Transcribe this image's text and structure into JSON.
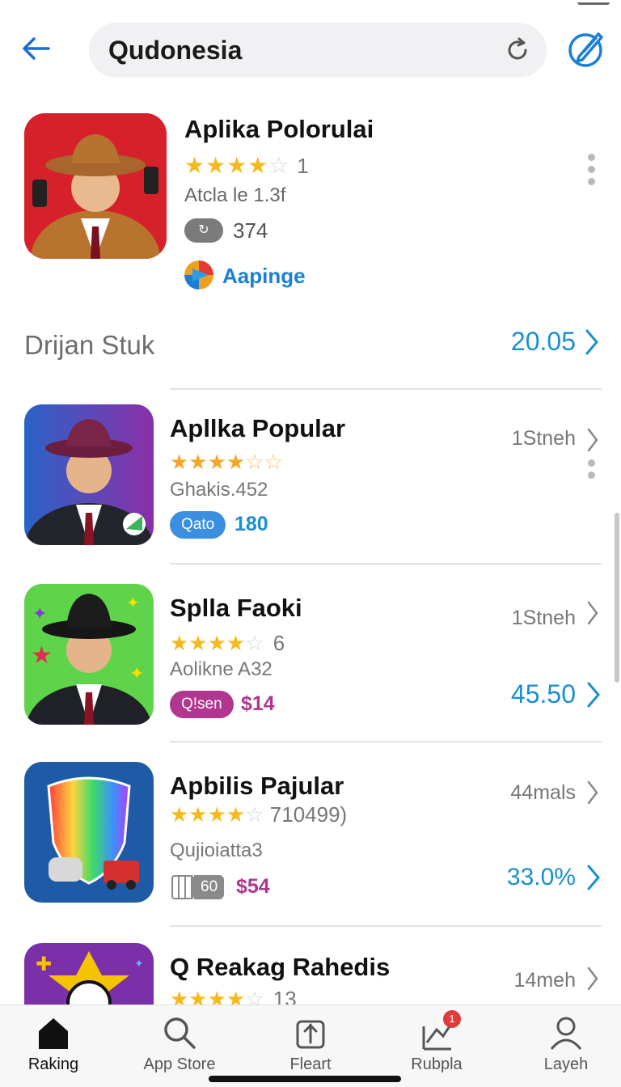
{
  "header": {
    "search_value": "Qudonesia",
    "back_icon": "back-arrow-icon",
    "refresh_icon": "refresh-icon",
    "edit_icon": "edit-pencil-icon",
    "accent": "#1a7fd6"
  },
  "featured": {
    "title": "Aplika Polorulai",
    "rating": 4,
    "rating_count": "1",
    "subtitle": "Atcla le 1.3f",
    "badge_label": "↻",
    "count": "374",
    "developer": "Aapinge"
  },
  "section": {
    "title": "Drijan Stuk",
    "value": "20.05"
  },
  "apps": [
    {
      "title": "Apllka Popular",
      "rating": 3.5,
      "rating_count": "",
      "subtitle": "Ghakis.452",
      "pill": "Qato",
      "pill_color": "#3b8fe0",
      "pill_value": "180",
      "pill_value_color": "#1a8fd1",
      "meta": "1Stneh",
      "price": ""
    },
    {
      "title": "Splla Faoki",
      "rating": 4,
      "rating_count": "6",
      "subtitle": "Aolikne A32",
      "pill": "Q!sen",
      "pill_color": "#b0368f",
      "pill_value": "$14",
      "pill_value_color": "#b0368f",
      "meta": "1Stneh",
      "price": "45.50"
    },
    {
      "title": "Apbilis Pajular",
      "rating": 4,
      "rating_count": "710499)",
      "subtitle": "Qujioiatta3",
      "pill": "60",
      "pill_color": "#8a8a8a",
      "pill_value": "$54",
      "pill_value_color": "#b0368f",
      "meta": "44mals",
      "price": "33.0%"
    },
    {
      "title": "Q Reakag Rahedis",
      "rating": 4,
      "rating_count": "13",
      "subtitle": "",
      "pill": "",
      "pill_color": "",
      "pill_value": "",
      "pill_value_color": "",
      "meta": "14meh",
      "price": ""
    }
  ],
  "nav": {
    "items": [
      {
        "label": "Raking",
        "icon": "home-icon"
      },
      {
        "label": "App Store",
        "icon": "search-icon"
      },
      {
        "label": "Fleart",
        "icon": "bookmark-icon"
      },
      {
        "label": "Rubpla",
        "icon": "updates-icon",
        "badge": "1"
      },
      {
        "label": "Layeh",
        "icon": "profile-icon"
      }
    ]
  }
}
